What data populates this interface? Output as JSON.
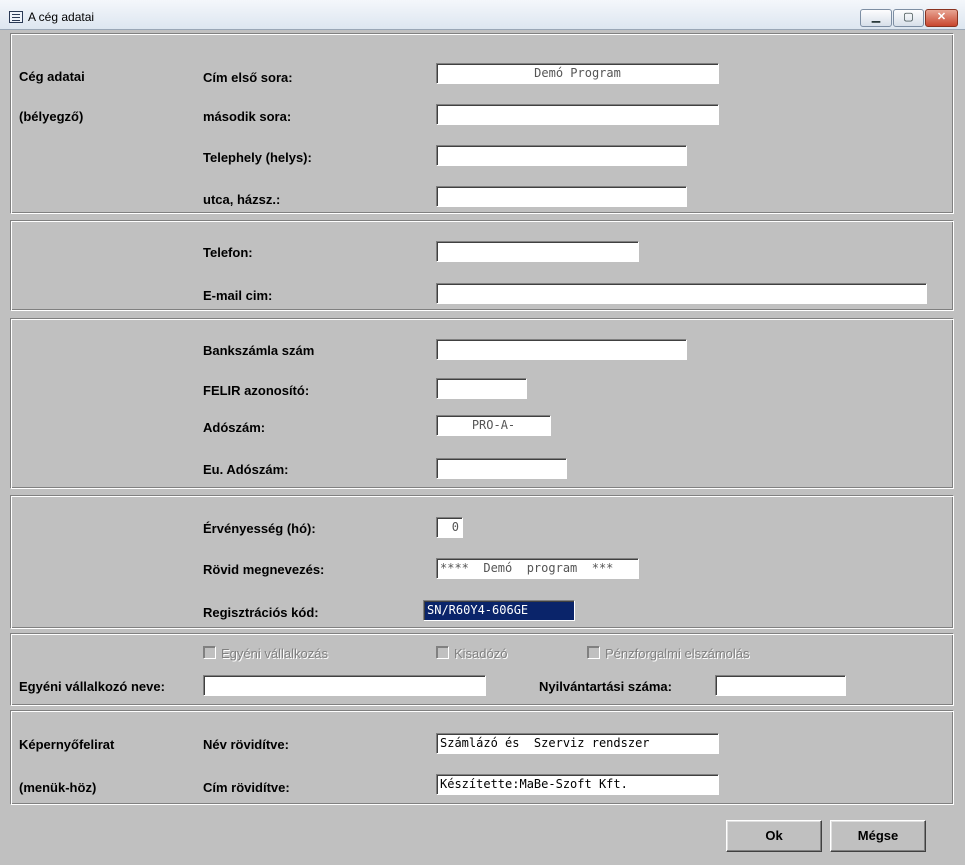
{
  "window": {
    "title": "A cég adatai",
    "minimize": "▁",
    "maximize": "▢",
    "close": "✕"
  },
  "company": {
    "section_label": "Cég adatai",
    "section_sublabel": "(bélyegző)",
    "address_line1_label": "Cím első sora:",
    "address_line1_value": "Demó Program",
    "address_line2_label": "második sora:",
    "address_line2_value": "",
    "site_label": "Telephely (helys):",
    "site_value": "",
    "street_label": "utca, házsz.:",
    "street_value": ""
  },
  "contact": {
    "phone_label": "Telefon:",
    "phone_value": "",
    "email_label": "E-mail cim:",
    "email_value": ""
  },
  "bank": {
    "account_label": "Bankszámla szám",
    "account_value": "",
    "felir_label": "FELIR azonosító:",
    "felir_value": "",
    "tax_label": "Adószám:",
    "tax_value": "PRO-A-",
    "eu_tax_label": "Eu. Adószám:",
    "eu_tax_value": ""
  },
  "license": {
    "validity_label": "Érvényesség (hó):",
    "validity_value": "0",
    "short_name_label": "Rövid megnevezés:",
    "short_name_value": "****  Demó  program  ***",
    "reg_code_label": "Regisztrációs kód:",
    "reg_code_value": "SN/R60Y4-606GE"
  },
  "sole_trader": {
    "chk_individual": "Egyéni vállalkozás",
    "chk_small_tax": "Kisadózó",
    "chk_cash_accounting": "Pénzforgalmi elszámolás",
    "name_label": "Egyéni vállalkozó neve:",
    "name_value": "",
    "reg_number_label": "Nyilvántartási száma:",
    "reg_number_value": ""
  },
  "screen_caption": {
    "section_label": "Képernyőfelirat",
    "section_sublabel": "(menük-höz)",
    "name_short_label": "Név rövidítve:",
    "name_short_value": "Számlázó és  Szerviz rendszer",
    "address_short_label": "Cím rövidítve:",
    "address_short_value": "Készítette:MaBe-Szoft Kft."
  },
  "buttons": {
    "ok": "Ok",
    "cancel": "Mégse"
  }
}
